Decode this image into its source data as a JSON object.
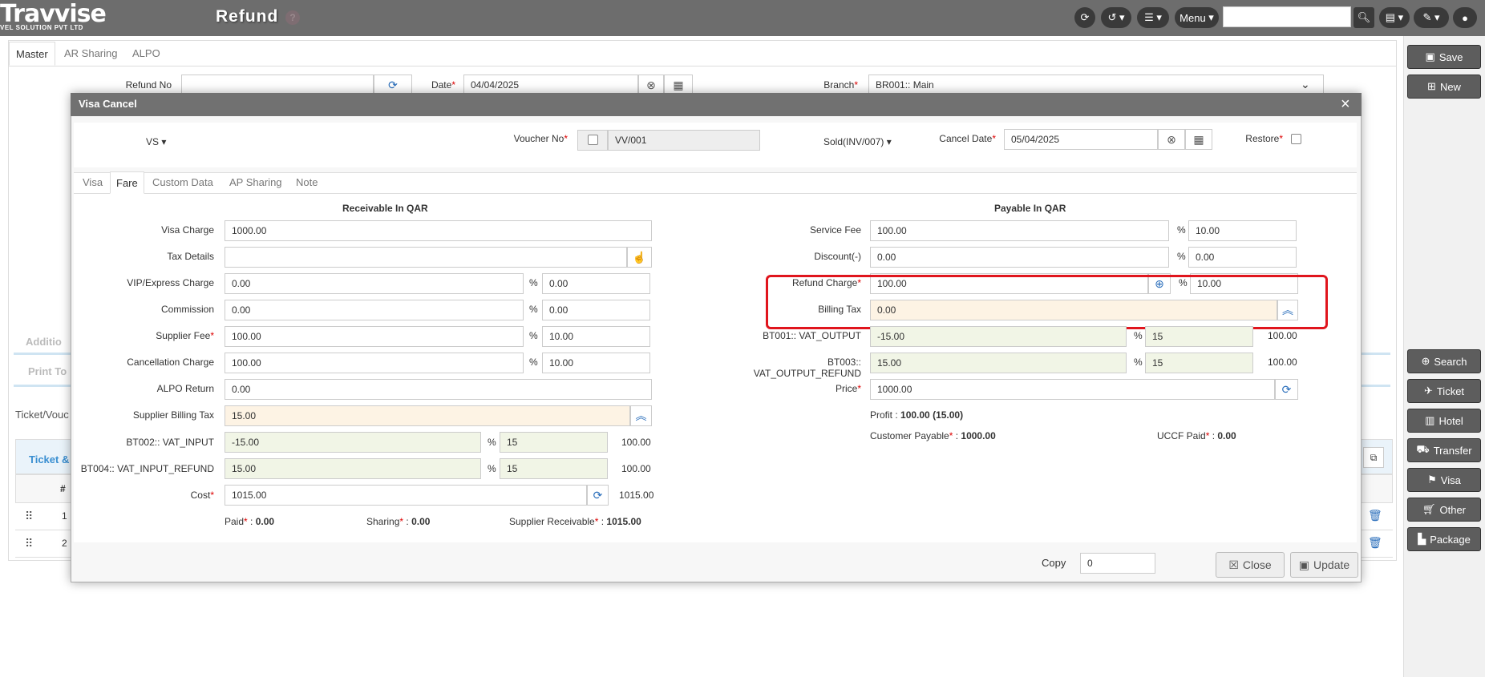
{
  "app": {
    "logo_main": "Travvise",
    "logo_sub": "VEL SOLUTION PVT LTD",
    "page_title": "Refund",
    "help": "?"
  },
  "topbar": {
    "menu_label": "Menu",
    "search_value": ""
  },
  "side_buttons": {
    "save": "Save",
    "new": "New",
    "search": "Search",
    "ticket": "Ticket",
    "hotel": "Hotel",
    "transfer": "Transfer",
    "visa": "Visa",
    "other": "Other",
    "package": "Package"
  },
  "bg": {
    "tabs": [
      "Master",
      "AR Sharing",
      "ALPO"
    ],
    "refund_no_label": "Refund No",
    "refund_no_value": "",
    "date_label": "Date",
    "date_value": "04/04/2025",
    "branch_label": "Branch",
    "branch_value": "BR001:: Main",
    "additional": "Additio",
    "print": "Print To",
    "ticket_section": "Ticket/Vouc",
    "ticket_tab": "Ticket &",
    "hash": "#",
    "rows": [
      "1",
      "2"
    ]
  },
  "modal": {
    "title": "Visa Cancel",
    "type_value": "VS",
    "voucher_label": "Voucher No",
    "voucher_value": "VV/001",
    "sold_label": "Sold(INV/007)",
    "cancel_date_label": "Cancel Date",
    "cancel_date_value": "05/04/2025",
    "restore_label": "Restore",
    "tabs": [
      "Visa",
      "Fare",
      "Custom Data",
      "AP Sharing",
      "Note"
    ],
    "receivable_title": "Receivable In QAR",
    "payable_title": "Payable In QAR",
    "left": {
      "visa_charge": {
        "label": "Visa Charge",
        "value": "1000.00"
      },
      "tax_details": {
        "label": "Tax Details",
        "value": ""
      },
      "vip": {
        "label": "VIP/Express Charge",
        "value": "0.00",
        "pct": "0.00"
      },
      "commission": {
        "label": "Commission",
        "value": "0.00",
        "pct": "0.00"
      },
      "supplier_fee": {
        "label": "Supplier Fee",
        "value": "100.00",
        "pct": "10.00"
      },
      "cancellation": {
        "label": "Cancellation Charge",
        "value": "100.00",
        "pct": "10.00"
      },
      "alpo": {
        "label": "ALPO Return",
        "value": "0.00"
      },
      "supplier_tax": {
        "label": "Supplier Billing Tax",
        "value": "15.00"
      },
      "bt002": {
        "label": "BT002:: VAT_INPUT",
        "value": "-15.00",
        "pct": "15",
        "amount": "100.00"
      },
      "bt004": {
        "label": "BT004:: VAT_INPUT_REFUND",
        "value": "15.00",
        "pct": "15",
        "amount": "100.00"
      },
      "cost": {
        "label": "Cost",
        "value": "1015.00",
        "amount": "1015.00"
      },
      "paid_label": "Paid",
      "paid_value": "0.00",
      "sharing_label": "Sharing",
      "sharing_value": "0.00",
      "supp_recv_label": "Supplier Receivable",
      "supp_recv_value": "1015.00"
    },
    "right": {
      "service_fee": {
        "label": "Service Fee",
        "value": "100.00",
        "pct": "10.00"
      },
      "discount": {
        "label": "Discount(-)",
        "value": "0.00",
        "pct": "0.00"
      },
      "refund_charge": {
        "label": "Refund Charge",
        "value": "100.00",
        "pct": "10.00"
      },
      "billing_tax": {
        "label": "Billing Tax",
        "value": "0.00"
      },
      "bt001": {
        "label": "BT001:: VAT_OUTPUT",
        "value": "-15.00",
        "pct": "15",
        "amount": "100.00"
      },
      "bt003": {
        "label": "BT003:: VAT_OUTPUT_REFUND",
        "value": "15.00",
        "pct": "15",
        "amount": "100.00"
      },
      "price": {
        "label": "Price",
        "value": "1000.00"
      },
      "profit_label": "Profit",
      "profit_value": "100.00 (15.00)",
      "cust_pay_label": "Customer Payable",
      "cust_pay_value": "1000.00",
      "uccf_label": "UCCF Paid",
      "uccf_value": "0.00"
    },
    "copy_label": "Copy",
    "copy_value": "0",
    "close_label": "Close",
    "update_label": "Update"
  },
  "symbols": {
    "percent": "%",
    "required": "*",
    "colon": ":"
  },
  "colors": {
    "topbar": "#6d6d6d",
    "highlight": "#e0151d",
    "link": "#2a6ebb"
  }
}
